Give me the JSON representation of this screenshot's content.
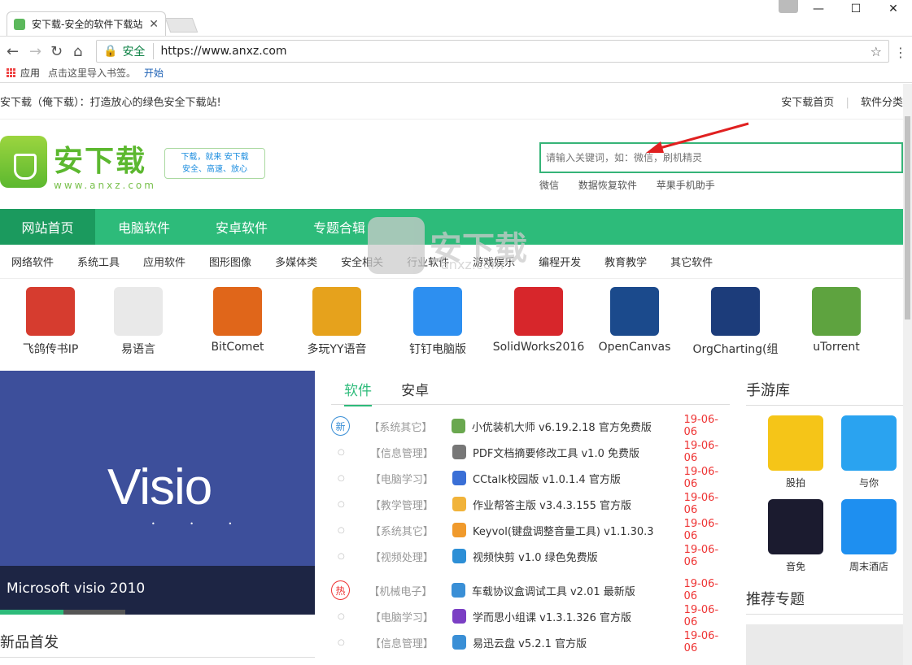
{
  "browser": {
    "tab_title": "安下载-安全的软件下载站",
    "url": "https://www.anxz.com",
    "secure_label": "安全",
    "bookmarks": [
      "应用",
      "点击这里导入书签。",
      "开始"
    ]
  },
  "site": {
    "topbar_slogan": "安下载（俺下载）：打造放心的绿色安全下载站!",
    "top_links": [
      "安下载首页",
      "软件分类"
    ],
    "logo_name": "安下载",
    "logo_domain": "www.anxz.com",
    "slogan_line1": "下载，就来 安下载",
    "slogan_line2": "安全、高速、放心",
    "search_placeholder": "请输入关键词，如：微信，刷机精灵",
    "hotwords": [
      "微信",
      "数据恢复软件",
      "苹果手机助手"
    ],
    "main_nav": [
      "网站首页",
      "电脑软件",
      "安卓软件",
      "专题合辑"
    ],
    "sub_nav": [
      "网络软件",
      "系统工具",
      "应用软件",
      "图形图像",
      "多媒体类",
      "安全相关",
      "行业软件",
      "游戏娱乐",
      "编程开发",
      "教育教学",
      "其它软件"
    ],
    "apps": [
      {
        "label": "飞鸽传书IP",
        "color": "#d63c2f"
      },
      {
        "label": "易语言",
        "color": "#e9e9e9"
      },
      {
        "label": "BitComet",
        "color": "#e0661a"
      },
      {
        "label": "多玩YY语音",
        "color": "#e6a21c"
      },
      {
        "label": "钉钉电脑版",
        "color": "#2d8ff0"
      },
      {
        "label": "SolidWorks2016",
        "color": "#d7262b"
      },
      {
        "label": "OpenCanvas",
        "color": "#1b4a8c"
      },
      {
        "label": "OrgCharting(组",
        "color": "#1c3c7a"
      },
      {
        "label": "uTorrent",
        "color": "#5ea33f"
      }
    ],
    "watermark": {
      "text": "安下载",
      "domain": "anxz.com"
    },
    "banner": {
      "title": "Visio",
      "caption": "Microsoft visio 2010"
    },
    "new_release": "新品首发",
    "soft_tabs": [
      "软件",
      "安卓"
    ],
    "list": [
      {
        "mark": "新",
        "cat": "【系统其它】",
        "name": "小优装机大师 v6.19.2.18 官方免费版",
        "date": "19-06-06",
        "color": "#6aa84f"
      },
      {
        "mark": "",
        "cat": "【信息管理】",
        "name": "PDF文档摘要修改工具 v1.0 免费版",
        "date": "19-06-06",
        "color": "#777777"
      },
      {
        "mark": "",
        "cat": "【电脑学习】",
        "name": "CCtalk校园版 v1.0.1.4 官方版",
        "date": "19-06-06",
        "color": "#3a6fd6"
      },
      {
        "mark": "",
        "cat": "【教学管理】",
        "name": "作业帮答主版 v3.4.3.155 官方版",
        "date": "19-06-06",
        "color": "#f1b33a"
      },
      {
        "mark": "",
        "cat": "【系统其它】",
        "name": "Keyvol(键盘调整音量工具) v1.1.30.3",
        "date": "19-06-06",
        "color": "#f09a2c"
      },
      {
        "mark": "",
        "cat": "【视频处理】",
        "name": "视频快剪 v1.0 绿色免费版",
        "date": "19-06-06",
        "color": "#2d8fd6"
      },
      {
        "mark": "热",
        "cat": "【机械电子】",
        "name": "车载协议盒调试工具 v2.01 最新版",
        "date": "19-06-06",
        "color": "#3a8fd6"
      },
      {
        "mark": "",
        "cat": "【电脑学习】",
        "name": "学而思小组课 v1.3.1.326 官方版",
        "date": "19-06-06",
        "color": "#7b3fc4"
      },
      {
        "mark": "",
        "cat": "【信息管理】",
        "name": "易迅云盘 v5.2.1 官方版",
        "date": "19-06-06",
        "color": "#3a8fd6"
      }
    ],
    "games_title": "手游库",
    "games": [
      {
        "label": "股拍",
        "color": "#f5c518"
      },
      {
        "label": "与你",
        "color": "#2aa3f0"
      },
      {
        "label": "音免",
        "color": "#1b1b2f"
      },
      {
        "label": "周末酒店",
        "color": "#1e8ff0"
      }
    ],
    "rec_title": "推荐专题"
  }
}
